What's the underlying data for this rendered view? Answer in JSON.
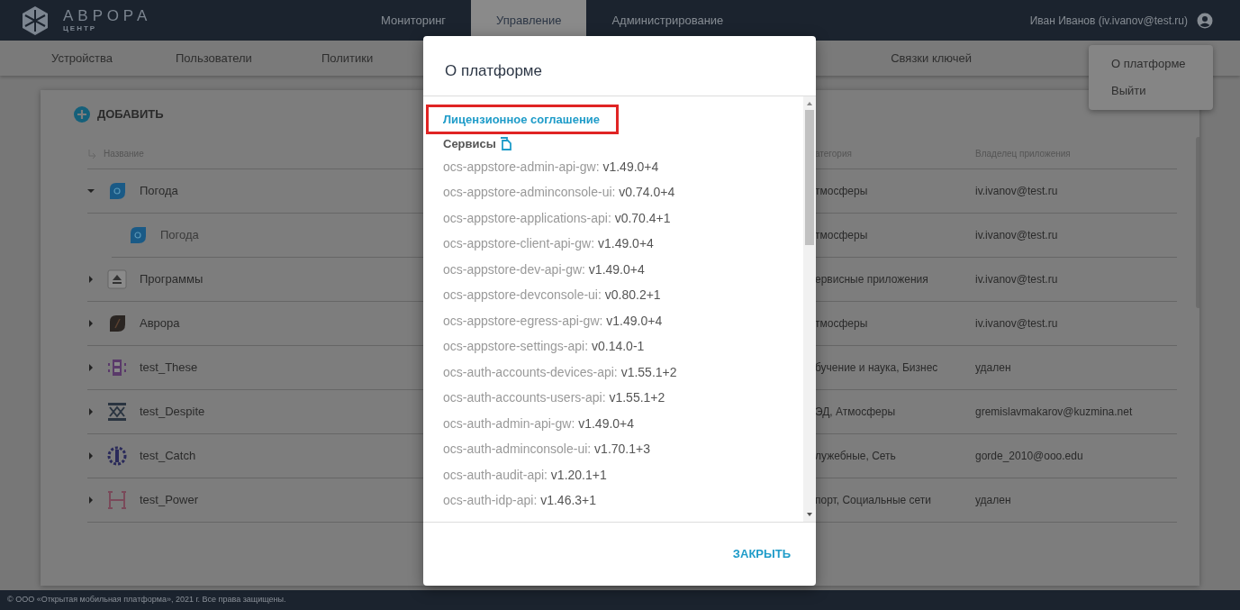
{
  "header": {
    "logo_title": "АВРОРА",
    "logo_subtitle": "ЦЕНТР",
    "nav": [
      {
        "label": "Мониторинг",
        "selected": false
      },
      {
        "label": "Управление",
        "selected": true
      },
      {
        "label": "Администрирование",
        "selected": false
      }
    ],
    "user": "Иван Иванов (iv.ivanov@test.ru)"
  },
  "subnav": [
    {
      "label": "Устройства"
    },
    {
      "label": "Пользователи"
    },
    {
      "label": "Политики"
    },
    {
      "label": "Связки ключей"
    }
  ],
  "user_menu": [
    {
      "label": "О платформе"
    },
    {
      "label": "Выйти"
    }
  ],
  "add_button": "ДОБАВИТЬ",
  "table": {
    "columns": [
      "Название",
      "атегория",
      "Владелец приложения"
    ],
    "rows": [
      {
        "name": "Погода",
        "category": "тмосферы",
        "owner": "iv.ivanov@test.ru",
        "expanded": true,
        "children": [
          {
            "name": "Погода",
            "category": "тмосферы",
            "owner": "iv.ivanov@test.ru"
          }
        ]
      },
      {
        "name": "Программы",
        "category": "ервисные приложения",
        "owner": "iv.ivanov@test.ru",
        "expanded": false
      },
      {
        "name": "Аврора",
        "category": "тмосферы",
        "owner": "iv.ivanov@test.ru",
        "expanded": false
      },
      {
        "name": "test_These",
        "category": "бучение и наука, Бизнес",
        "owner": "удален",
        "expanded": false
      },
      {
        "name": "test_Despite",
        "category": "ЭД, Атмосферы",
        "owner": "gremislavmakarov@kuzmina.net",
        "expanded": false
      },
      {
        "name": "test_Catch",
        "category": "лужебные, Сеть",
        "owner": "gorde_2010@ooo.edu",
        "expanded": false
      },
      {
        "name": "test_Power",
        "category": "порт, Социальные сети",
        "owner": "удален",
        "expanded": false
      }
    ]
  },
  "dialog": {
    "title": "О платформе",
    "license_link": "Лицензионное соглашение",
    "services_label": "Сервисы",
    "services": [
      {
        "name": "ocs-appstore-admin-api-gw:",
        "version": "v1.49.0+4"
      },
      {
        "name": "ocs-appstore-adminconsole-ui:",
        "version": "v0.74.0+4"
      },
      {
        "name": "ocs-appstore-applications-api:",
        "version": "v0.70.4+1"
      },
      {
        "name": "ocs-appstore-client-api-gw:",
        "version": "v1.49.0+4"
      },
      {
        "name": "ocs-appstore-dev-api-gw:",
        "version": "v1.49.0+4"
      },
      {
        "name": "ocs-appstore-devconsole-ui:",
        "version": "v0.80.2+1"
      },
      {
        "name": "ocs-appstore-egress-api-gw:",
        "version": "v1.49.0+4"
      },
      {
        "name": "ocs-appstore-settings-api:",
        "version": "v0.14.0-1"
      },
      {
        "name": "ocs-auth-accounts-devices-api:",
        "version": "v1.55.1+2"
      },
      {
        "name": "ocs-auth-accounts-users-api:",
        "version": "v1.55.1+2"
      },
      {
        "name": "ocs-auth-admin-api-gw:",
        "version": "v1.49.0+4"
      },
      {
        "name": "ocs-auth-adminconsole-ui:",
        "version": "v1.70.1+3"
      },
      {
        "name": "ocs-auth-audit-api:",
        "version": "v1.20.1+1"
      },
      {
        "name": "ocs-auth-idp-api:",
        "version": "v1.46.3+1"
      }
    ],
    "close_button": "ЗАКРЫТЬ"
  },
  "footer": "© ООО «Открытая мобильная платформа», 2021 г. Все права защищены."
}
